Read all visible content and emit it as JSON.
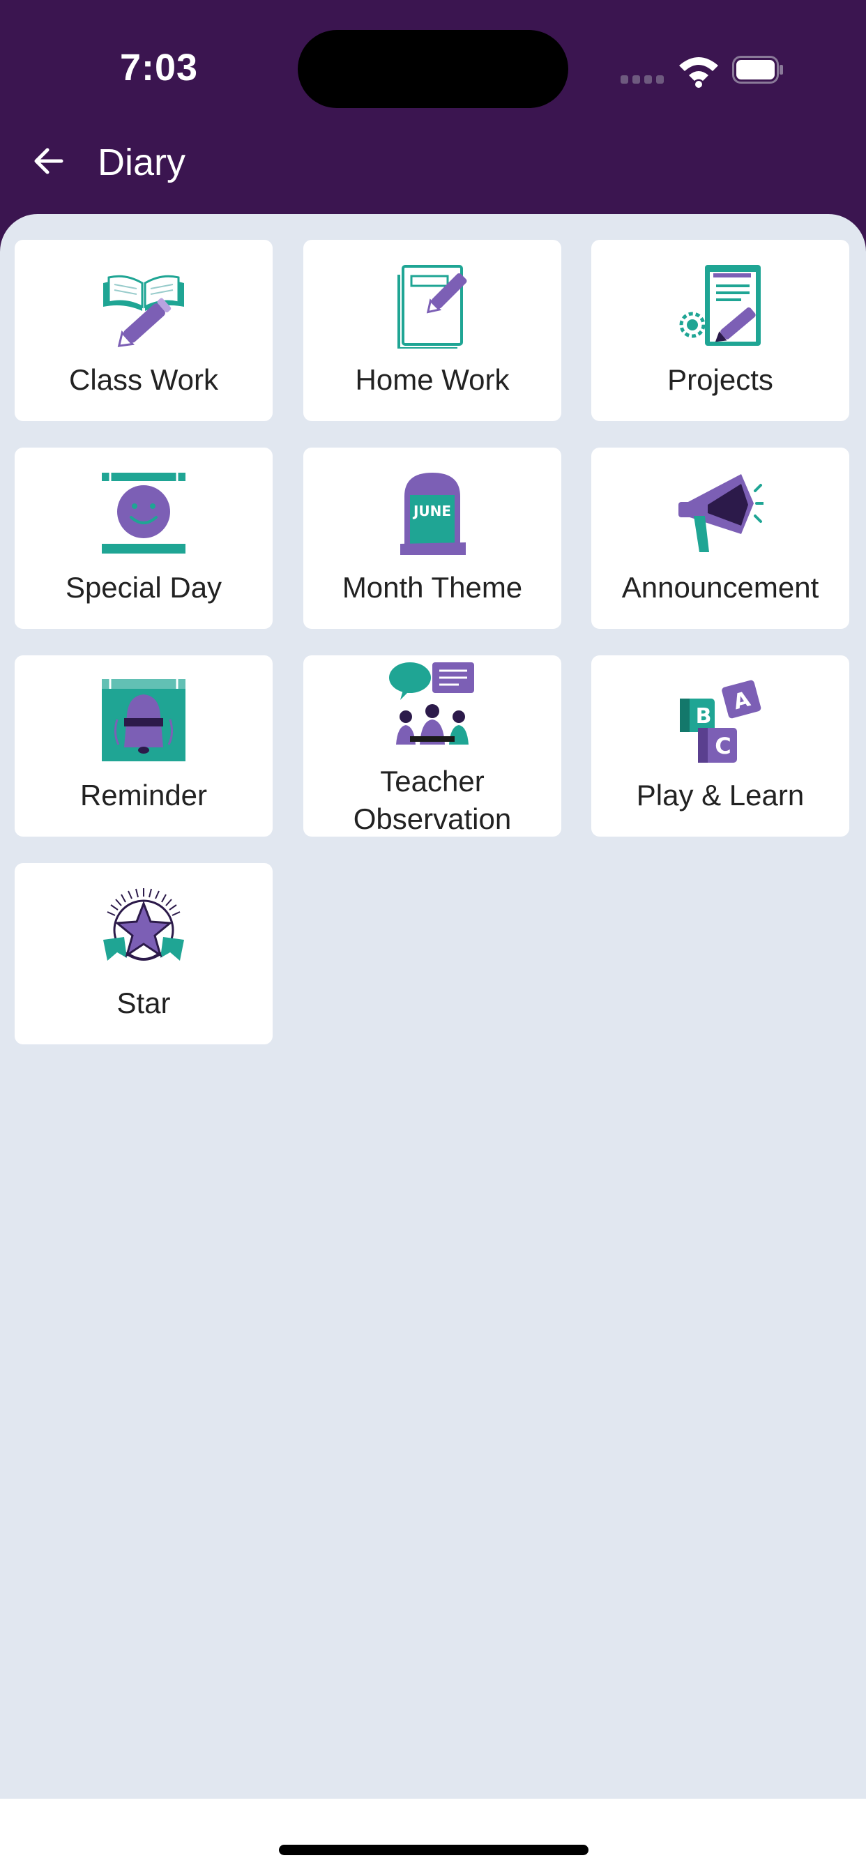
{
  "status_bar": {
    "time": "7:03"
  },
  "app_bar": {
    "title": "Diary"
  },
  "colors": {
    "header": "#3b1550",
    "background": "#e1e7f0",
    "teal": "#1fa594",
    "purple": "#7c5fb5",
    "dark_purple": "#2c1a4a"
  },
  "menu": [
    {
      "label": "Class Work",
      "icon": "open-book-pencil-icon"
    },
    {
      "label": "Home Work",
      "icon": "notebook-pencil-icon"
    },
    {
      "label": "Projects",
      "icon": "clipboard-gear-icon"
    },
    {
      "label": "Special Day",
      "icon": "calendar-smiley-icon"
    },
    {
      "label": "Month Theme",
      "icon": "june-calendar-icon"
    },
    {
      "label": "Announcement",
      "icon": "megaphone-icon"
    },
    {
      "label": "Reminder",
      "icon": "calendar-bell-icon"
    },
    {
      "label": "Teacher Observation",
      "label_line1": "Teacher",
      "label_line2": "Observation",
      "icon": "teacher-meeting-icon"
    },
    {
      "label": "Play & Learn",
      "icon": "abc-blocks-icon"
    },
    {
      "label": "Star",
      "icon": "star-badge-icon"
    }
  ],
  "icon_text": {
    "june": "JUNE",
    "block_a": "A",
    "block_b": "B",
    "block_c": "C"
  }
}
